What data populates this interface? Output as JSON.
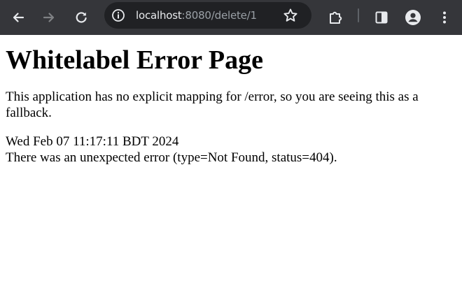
{
  "browser": {
    "url_host": "localhost",
    "url_rest": ":8080/delete/1",
    "icons": {
      "back": "back-arrow-icon",
      "forward": "forward-arrow-icon",
      "reload": "reload-icon",
      "site_info": "site-info-icon",
      "bookmark": "star-icon",
      "extensions": "puzzle-icon",
      "side_panel": "side-panel-icon",
      "profile": "profile-icon",
      "menu": "kebab-menu-icon"
    },
    "colors": {
      "toolbar": "#35363a",
      "omnibox": "#202124",
      "icon_active": "#e8eaed",
      "icon_disabled": "#7f8184"
    }
  },
  "page": {
    "title": "Whitelabel Error Page",
    "description": "This application has no explicit mapping for /error, so you are seeing this as a fallback.",
    "timestamp": "Wed Feb 07 11:17:11 BDT 2024",
    "error_message": "There was an unexpected error (type=Not Found, status=404)."
  }
}
